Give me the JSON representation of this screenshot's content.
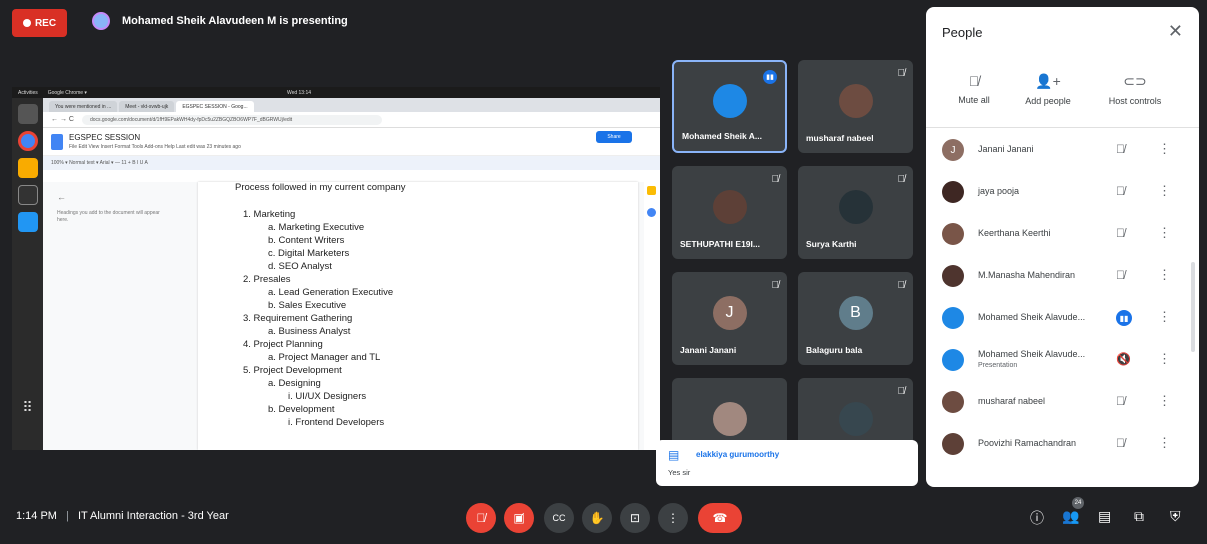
{
  "topbar": {
    "rec_label": "REC",
    "presenting": "Mohamed Sheik Alavudeen M is presenting"
  },
  "shared_screen": {
    "ubuntu": {
      "activities": "Activities",
      "app": "Google Chrome ▾",
      "clock": "Wed 13:14"
    },
    "tabs": [
      "You were mentioned in ...",
      "Meet - vkt-svwb-ujk",
      "EGSPEC SESSION - Goog..."
    ],
    "url": "docs.google.com/document/d/1fH9EPakWH4dy-fpDc5u2ZBGQZBO6WP7F_dBGRWUj/edit",
    "doc_title": "EGSPEC SESSION",
    "doc_menu": "File  Edit  View  Insert  Format  Tools  Add-ons  Help  Last edit was 23 minutes ago",
    "share": "Share",
    "toolbar": "100%  ▾  Normal text  ▾  Arial  ▾  —  11  +  B  I  U  A",
    "outline_hint": "Headings you add to the document will appear here.",
    "doc_lines": [
      "Process followed in my current company",
      "1. Marketing",
      "a. Marketing Executive",
      "b. Content Writers",
      "c. Digital Marketers",
      "d. SEO Analyst",
      "2. Presales",
      "a. Lead Generation Executive",
      "b. Sales Executive",
      "3. Requirement Gathering",
      "a. Business Analyst",
      "4. Project Planning",
      "a. Project Manager and TL",
      "5. Project Development",
      "a. Designing",
      "i.   UI/UX Designers",
      "b. Development",
      "i.   Frontend Developers"
    ]
  },
  "tiles": [
    {
      "name": "Mohamed Sheik A...",
      "speaking": true
    },
    {
      "name": "musharaf nabeel"
    },
    {
      "name": "SETHUPATHI E19I..."
    },
    {
      "name": "Surya Karthi"
    },
    {
      "name": "Janani Janani",
      "initial": "J"
    },
    {
      "name": "Balaguru bala",
      "initial": "B"
    },
    {
      "name": ""
    },
    {
      "name": ""
    }
  ],
  "chat_toast": {
    "sender": "elakkiya gurumoorthy",
    "message": "Yes sir"
  },
  "people_panel": {
    "title": "People",
    "actions": [
      "Mute all",
      "Add people",
      "Host controls"
    ],
    "participants": [
      {
        "name": "Janani Janani",
        "initial": "J"
      },
      {
        "name": "jaya pooja"
      },
      {
        "name": "Keerthana Keerthi"
      },
      {
        "name": "M.Manasha Mahendiran"
      },
      {
        "name": "Mohamed Sheik Alavude...",
        "speaking": true
      },
      {
        "name": "Mohamed Sheik Alavude...",
        "sub": "Presentation"
      },
      {
        "name": "musharaf nabeel"
      },
      {
        "name": "Poovizhi Ramachandran"
      }
    ]
  },
  "bottombar": {
    "time": "1:14 PM",
    "separator": "|",
    "meeting_title": "IT Alumni Interaction - 3rd Year",
    "participant_count": "24"
  },
  "colors": {
    "meet_bg": "#202124",
    "tile_bg": "#3c4043",
    "red": "#ea4335",
    "blue": "#1a73e8"
  }
}
